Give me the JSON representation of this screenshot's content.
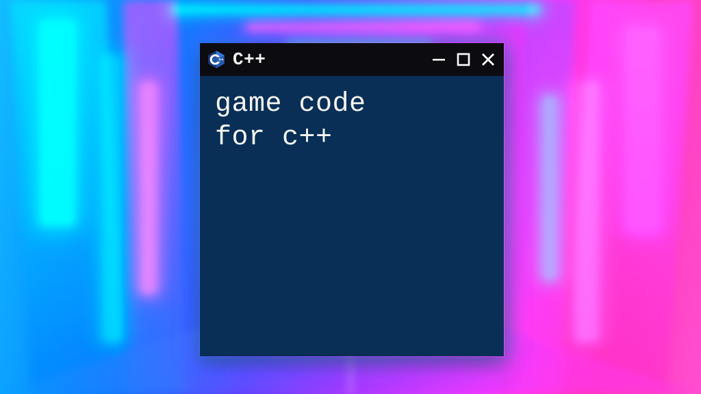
{
  "window": {
    "title": "C++",
    "icon": "cpp-logo-icon",
    "controls": {
      "minimize_icon": "minimize-icon",
      "maximize_icon": "maximize-icon",
      "close_icon": "close-icon"
    }
  },
  "content": {
    "text": "game code\nfor c++"
  },
  "colors": {
    "titlebar_bg": "#0c0c10",
    "content_bg": "#0c2f53",
    "text": "#f5f5f0"
  }
}
